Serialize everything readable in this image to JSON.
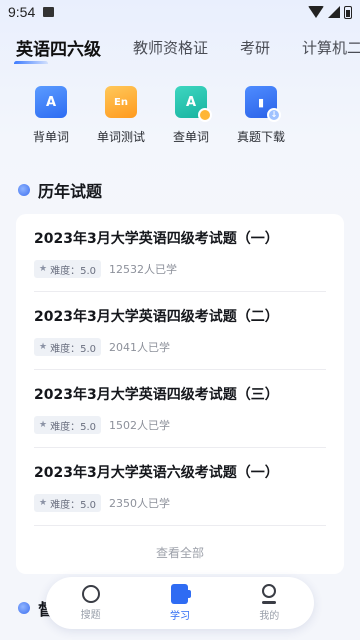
{
  "status_bar": {
    "time": "9:54"
  },
  "tabs": [
    {
      "label": "英语四六级",
      "active": true
    },
    {
      "label": "教师资格证",
      "active": false
    },
    {
      "label": "考研",
      "active": false
    },
    {
      "label": "计算机二级",
      "active": false
    }
  ],
  "features": [
    {
      "label": "背单词",
      "icon": "flashcard-icon",
      "glyph": "A"
    },
    {
      "label": "单词测试",
      "icon": "word-test-icon",
      "glyph": "En"
    },
    {
      "label": "查单词",
      "icon": "word-lookup-icon",
      "glyph": "A"
    },
    {
      "label": "真题下载",
      "icon": "download-icon",
      "glyph": "▮"
    }
  ],
  "past_papers": {
    "title": "历年试题",
    "items": [
      {
        "title": "2023年3月大学英语四级考试题（一）",
        "difficulty": "难度：5.0",
        "learners": "12532人已学"
      },
      {
        "title": "2023年3月大学英语四级考试题（二）",
        "difficulty": "难度：5.0",
        "learners": "2041人已学"
      },
      {
        "title": "2023年3月大学英语四级考试题（三）",
        "difficulty": "难度：5.0",
        "learners": "1502人已学"
      },
      {
        "title": "2023年3月大学英语六级考试题（一）",
        "difficulty": "难度：5.0",
        "learners": "2350人已学"
      }
    ],
    "view_all": "查看全部"
  },
  "next_section": {
    "title": "督"
  },
  "bottom_nav": [
    {
      "label": "搜题",
      "icon": "search-icon",
      "active": false
    },
    {
      "label": "学习",
      "icon": "book-icon",
      "active": true
    },
    {
      "label": "我的",
      "icon": "user-icon",
      "active": false
    }
  ],
  "colors": {
    "accent": "#2f6cf3",
    "background": "#f4f6fb"
  }
}
